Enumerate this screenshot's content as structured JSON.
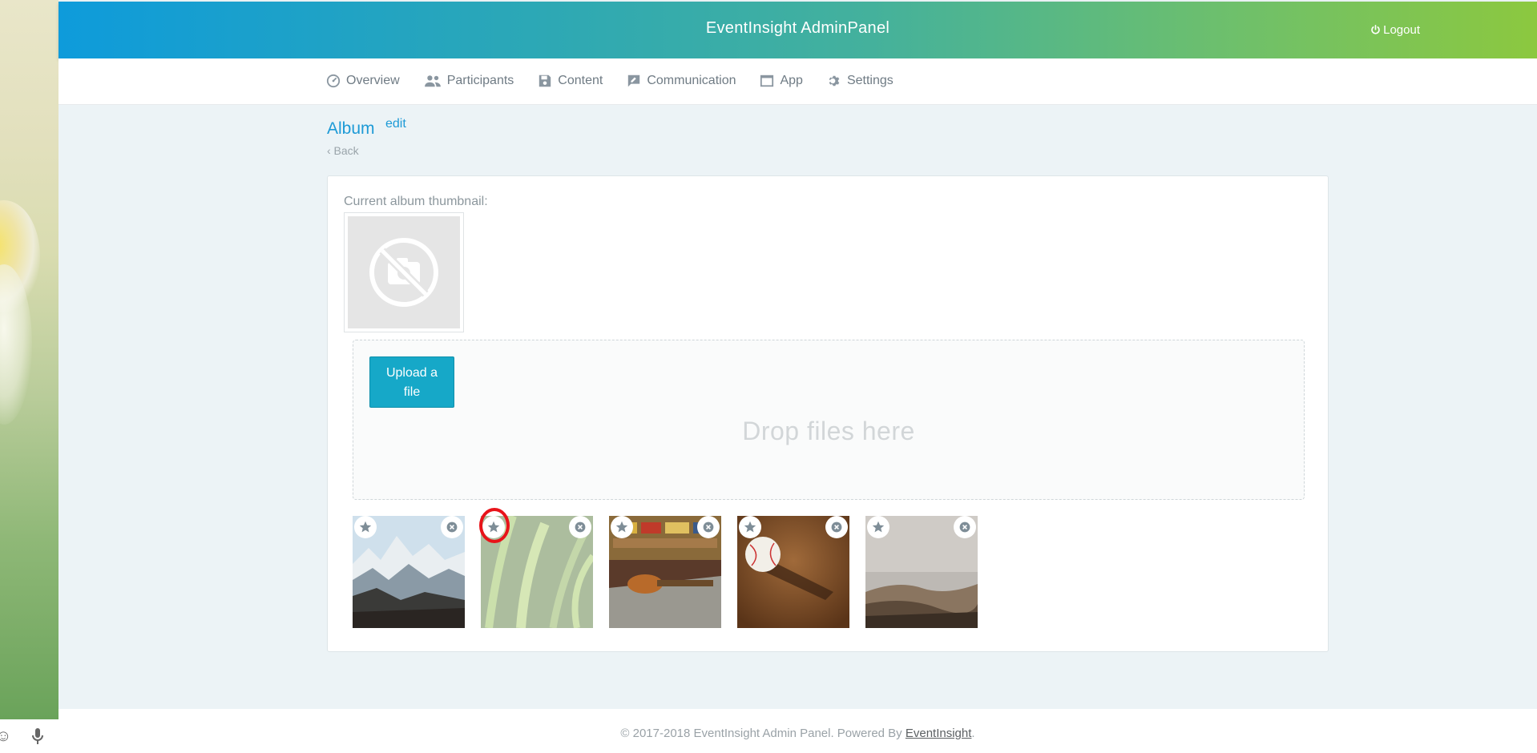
{
  "app": {
    "title": "EventInsight AdminPanel",
    "logout_label": "Logout"
  },
  "nav": {
    "items": [
      {
        "label": "Overview",
        "icon": "dashboard-icon"
      },
      {
        "label": "Participants",
        "icon": "people-icon"
      },
      {
        "label": "Content",
        "icon": "save-icon"
      },
      {
        "label": "Communication",
        "icon": "chat-icon"
      },
      {
        "label": "App",
        "icon": "window-icon"
      },
      {
        "label": "Settings",
        "icon": "gear-icon"
      }
    ]
  },
  "page": {
    "title": "Album",
    "edit_label": "edit",
    "back_label": "‹ Back"
  },
  "card": {
    "thumbnail_label": "Current album thumbnail:",
    "upload_label_line1": "Upload a",
    "upload_label_line2": "file",
    "drop_text": "Drop files here"
  },
  "photos": [
    {
      "name": "snowy-mountains",
      "faded": false
    },
    {
      "name": "green-plants",
      "faded": true
    },
    {
      "name": "guitar-workshop",
      "faded": false
    },
    {
      "name": "baseball-on-dirt",
      "faded": false
    },
    {
      "name": "misty-hills",
      "faded": false
    }
  ],
  "footer": {
    "text": "© 2017-2018 EventInsight Admin Panel. Powered By ",
    "link_label": "EventInsight",
    "suffix": "."
  },
  "colors": {
    "accent": "#1d9ad6",
    "upload_button": "#16a8c8",
    "highlight": "#e8141a"
  }
}
